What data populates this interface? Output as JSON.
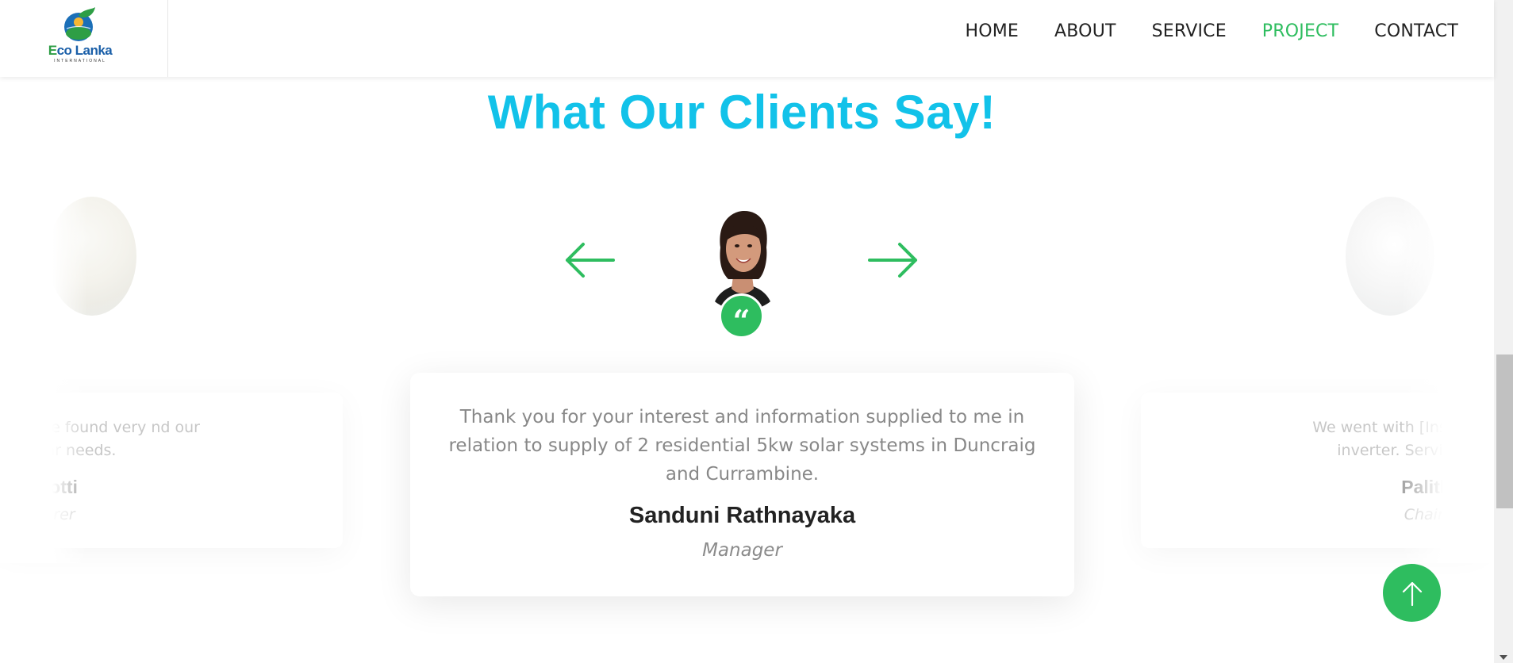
{
  "brand": {
    "name_prefix": "E",
    "name_rest": "co Lanka",
    "subtitle": "INTERNATIONAL"
  },
  "nav": {
    "items": [
      {
        "label": "HOME",
        "active": false
      },
      {
        "label": "ABOUT",
        "active": false
      },
      {
        "label": "SERVICE",
        "active": false
      },
      {
        "label": "PROJECT",
        "active": true
      },
      {
        "label": "CONTACT",
        "active": false
      }
    ]
  },
  "section": {
    "title": "What Our Clients Say!"
  },
  "testimonials": {
    "current": {
      "quote": "Thank you for your interest and information supplied to me in relation to supply of 2 residential 5kw solar systems in Duncraig and Currambine.",
      "name": "Sanduni Rathnayaka",
      "role": "Manager"
    },
    "previous": {
      "quote": "olar power which we found very nd our particular needs.",
      "name": "ohotti",
      "role": "cturer"
    },
    "next": {
      "quote": "We went with [Installer], and th inverter. Service was exc",
      "name": "Palitha",
      "role": "Chairm"
    }
  },
  "quote_symbol": "“",
  "colors": {
    "accent": "#2ebd5f",
    "title": "#12c2e9",
    "nav_text": "#222222"
  },
  "icons": {
    "prev": "arrow-left-icon",
    "next": "arrow-right-icon",
    "back_to_top": "arrow-up-icon",
    "quote": "quote-icon"
  }
}
